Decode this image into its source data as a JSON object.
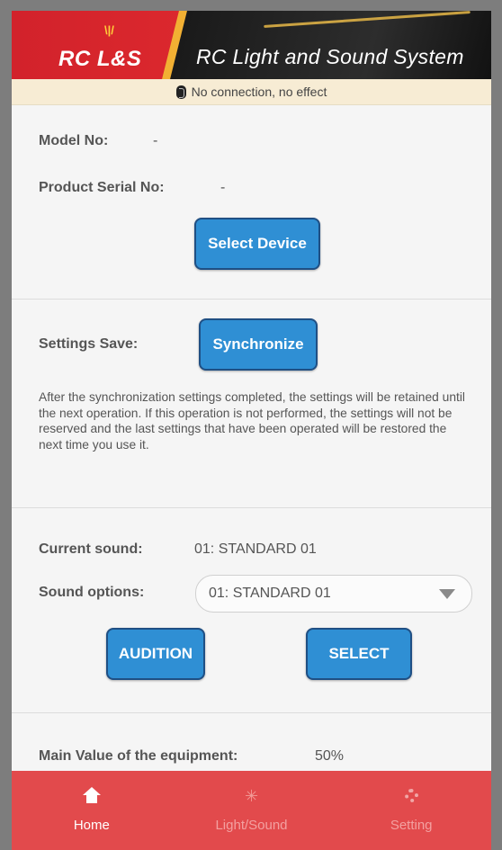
{
  "header": {
    "logo": "RC L&S",
    "subtitle": "RC Light and Sound System"
  },
  "status": {
    "icon": "bluetooth-icon",
    "text": "No connection, no effect"
  },
  "device": {
    "model_label": "Model No:",
    "model_value": "-",
    "serial_label": "Product Serial No:",
    "serial_value": "-",
    "select_button": "Select Device"
  },
  "settings": {
    "label": "Settings Save:",
    "sync_button": "Synchronize",
    "description": "After the synchronization settings completed, the settings will be retained until the next operation. If this operation is not performed, the settings will not be reserved and the last settings that have been operated will be restored the next time you use it."
  },
  "sound": {
    "current_label": "Current sound:",
    "current_value": "01: STANDARD 01",
    "options_label": "Sound options:",
    "options_selected": "01: STANDARD 01",
    "audition_button": "AUDITION",
    "select_button": "SELECT"
  },
  "main_value": {
    "label": "Main Value of the equipment:",
    "value": "50%"
  },
  "nav": {
    "items": [
      {
        "label": "Home",
        "icon": "home-icon",
        "active": true
      },
      {
        "label": "Light/Sound",
        "icon": "light-icon",
        "active": false
      },
      {
        "label": "Setting",
        "icon": "gear-icon",
        "active": false
      }
    ]
  },
  "colors": {
    "header_red": "#d2222b",
    "button_blue": "#2f8fd4",
    "nav_red": "#e24a4c",
    "status_bg": "#f7ecd4"
  }
}
